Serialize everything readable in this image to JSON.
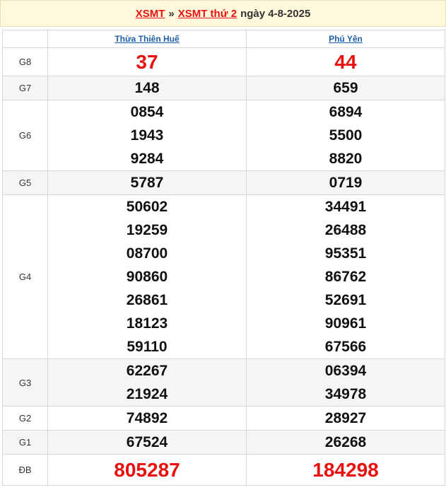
{
  "header": {
    "link1": "XSMT",
    "separator": "»",
    "link2": "XSMT thứ 2",
    "date_text": "ngày 4-8-2025"
  },
  "table": {
    "provinces": [
      "Thừa Thiên Huế",
      "Phú Yên"
    ],
    "rows": [
      {
        "label": "G8",
        "values": [
          [
            "37"
          ],
          [
            "44"
          ]
        ],
        "highlight": true
      },
      {
        "label": "G7",
        "values": [
          [
            "148"
          ],
          [
            "659"
          ]
        ]
      },
      {
        "label": "G6",
        "values": [
          [
            "0854",
            "1943",
            "9284"
          ],
          [
            "6894",
            "5500",
            "8820"
          ]
        ]
      },
      {
        "label": "G5",
        "values": [
          [
            "5787"
          ],
          [
            "0719"
          ]
        ]
      },
      {
        "label": "G4",
        "values": [
          [
            "50602",
            "19259",
            "08700",
            "90860",
            "26861",
            "18123",
            "59110"
          ],
          [
            "34491",
            "26488",
            "95351",
            "86762",
            "52691",
            "90961",
            "67566"
          ]
        ]
      },
      {
        "label": "G3",
        "values": [
          [
            "62267",
            "21924"
          ],
          [
            "06394",
            "34978"
          ]
        ]
      },
      {
        "label": "G2",
        "values": [
          [
            "74892"
          ],
          [
            "28927"
          ]
        ]
      },
      {
        "label": "G1",
        "values": [
          [
            "67524"
          ],
          [
            "26268"
          ]
        ]
      },
      {
        "label": "ĐB",
        "values": [
          [
            "805287"
          ],
          [
            "184298"
          ]
        ],
        "highlight": true
      }
    ]
  },
  "colors": {
    "accent_red": "#e8110f",
    "link_blue": "#1f5ea8",
    "header_bg": "#fff8dc"
  }
}
